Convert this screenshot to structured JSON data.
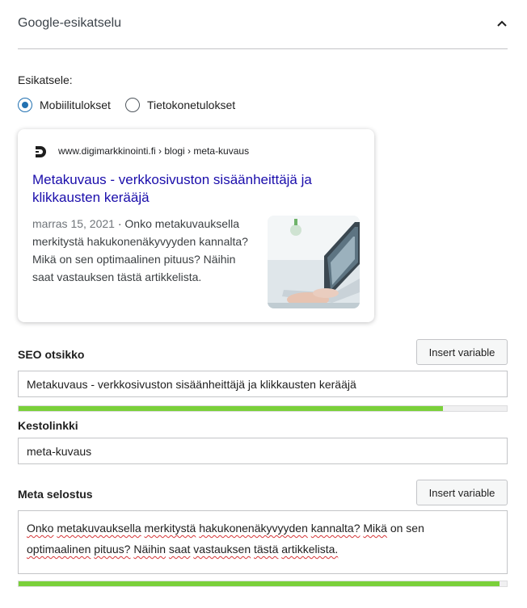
{
  "panel": {
    "title": "Google-esikatselu"
  },
  "preview": {
    "label": "Esikatsele:",
    "options": [
      {
        "label": "Mobiilitulokset",
        "checked": true
      },
      {
        "label": "Tietokonetulokset",
        "checked": false
      }
    ]
  },
  "result": {
    "breadcrumb": "www.digimarkkinointi.fi › blogi › meta-kuvaus",
    "title": "Metakuvaus - verkkosivuston sisäänheittäjä ja klikkausten kerääjä",
    "date": "marras 15, 2021",
    "separator": " · ",
    "snippet": "Onko metakuvauksella merkitystä hakukonenäkyvyyden kannalta? Mikä on sen optimaalinen pituus? Näihin saat vastauksen tästä artikkelista."
  },
  "seo_title": {
    "label": "SEO otsikko",
    "button": "Insert variable",
    "value": "Metakuvaus - verkkosivuston sisäänheittäjä ja klikkausten kerääjä",
    "progress": 0.87,
    "progress_color": "#7ad03a"
  },
  "slug": {
    "label": "Kestolinkki",
    "value": "meta-kuvaus"
  },
  "meta": {
    "label": "Meta selostus",
    "button": "Insert variable",
    "line1": [
      "Onko",
      " ",
      "metakuvauksella",
      " ",
      "merkitystä",
      " ",
      "hakukonenäkyvyyden",
      " ",
      "kannalta?",
      " ",
      "Mikä",
      " on sen"
    ],
    "line2": [
      "optimaalinen",
      " ",
      "pituus?",
      " ",
      "Näihin",
      " ",
      "saat",
      " ",
      "vastauksen",
      " ",
      "tästä",
      " ",
      "artikkelista."
    ],
    "progress": 0.985,
    "progress_color": "#7ad03a"
  },
  "colors": {
    "accent": "#2271b1",
    "link": "#1a0dab",
    "good": "#7ad03a",
    "spellcheck": "#d63638"
  },
  "icons": {
    "collapse": "chevron-up-icon",
    "site_logo": "site-logo-icon"
  }
}
